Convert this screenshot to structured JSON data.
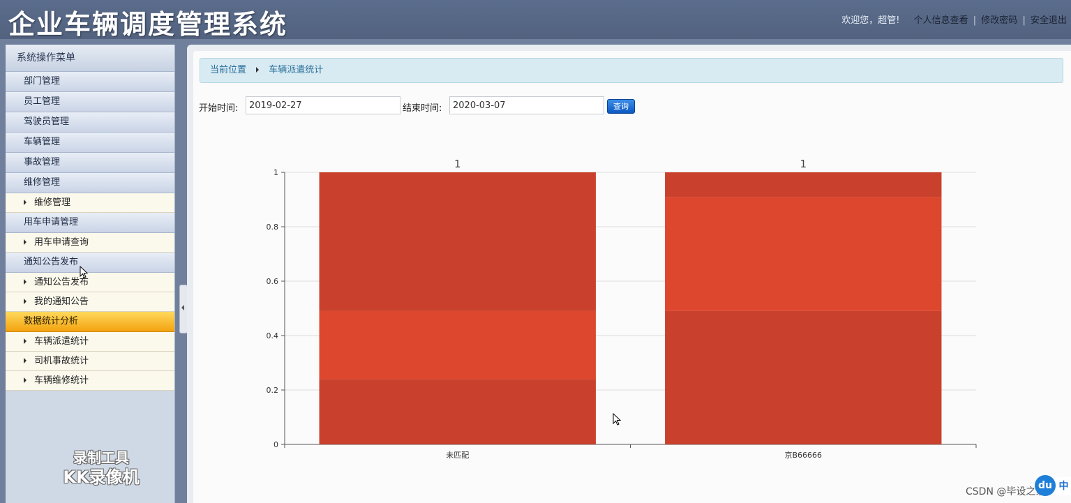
{
  "header": {
    "title": "企业车辆调度管理系统",
    "welcome": "欢迎您，超管!",
    "links": [
      "个人信息查看",
      "修改密码",
      "安全退出"
    ],
    "separator": "|"
  },
  "sidebar": {
    "title": "系统操作菜单",
    "items": [
      {
        "type": "cat",
        "label": "部门管理"
      },
      {
        "type": "cat",
        "label": "员工管理"
      },
      {
        "type": "cat",
        "label": "驾驶员管理"
      },
      {
        "type": "cat",
        "label": "车辆管理"
      },
      {
        "type": "cat",
        "label": "事故管理"
      },
      {
        "type": "cat",
        "label": "维修管理"
      },
      {
        "type": "sub",
        "label": "维修管理"
      },
      {
        "type": "cat",
        "label": "用车申请管理"
      },
      {
        "type": "sub",
        "label": "用车申请查询"
      },
      {
        "type": "cat",
        "label": "通知公告发布"
      },
      {
        "type": "sub",
        "label": "通知公告发布"
      },
      {
        "type": "sub",
        "label": "我的通知公告"
      },
      {
        "type": "cat",
        "label": "数据统计分析",
        "active": true
      },
      {
        "type": "sub",
        "label": "车辆派遣统计"
      },
      {
        "type": "sub",
        "label": "司机事故统计"
      },
      {
        "type": "sub",
        "label": "车辆维修统计"
      }
    ],
    "watermark": {
      "line1": "录制工具",
      "line2": "KK录像机"
    }
  },
  "breadcrumb": {
    "home": "当前位置",
    "current": "车辆派遣统计"
  },
  "filter": {
    "start_label": "开始时间:",
    "start_value": "2019-02-27",
    "end_label": "结束时间:",
    "end_value": "2020-03-07",
    "query_label": "查询"
  },
  "chart_data": {
    "type": "bar",
    "stacked": true,
    "categories": [
      "未匹配",
      "京B66666"
    ],
    "totals": [
      1,
      1
    ],
    "segments": [
      [
        0.24,
        0.25,
        0.51
      ],
      [
        0.49,
        0.42,
        0.09
      ]
    ],
    "segment_colors": [
      [
        "#c9412c",
        "#dc472e",
        "#c9412c"
      ],
      [
        "#c9412c",
        "#dc472e",
        "#c9412c"
      ]
    ],
    "ylim": [
      0,
      1
    ],
    "yticks": [
      "0",
      "0.2",
      "0.4",
      "0.6",
      "0.8",
      "1"
    ],
    "grid": true
  },
  "footer": {
    "csdn": "CSDN @毕设之家",
    "badge": "du",
    "badge_zh": "中"
  }
}
